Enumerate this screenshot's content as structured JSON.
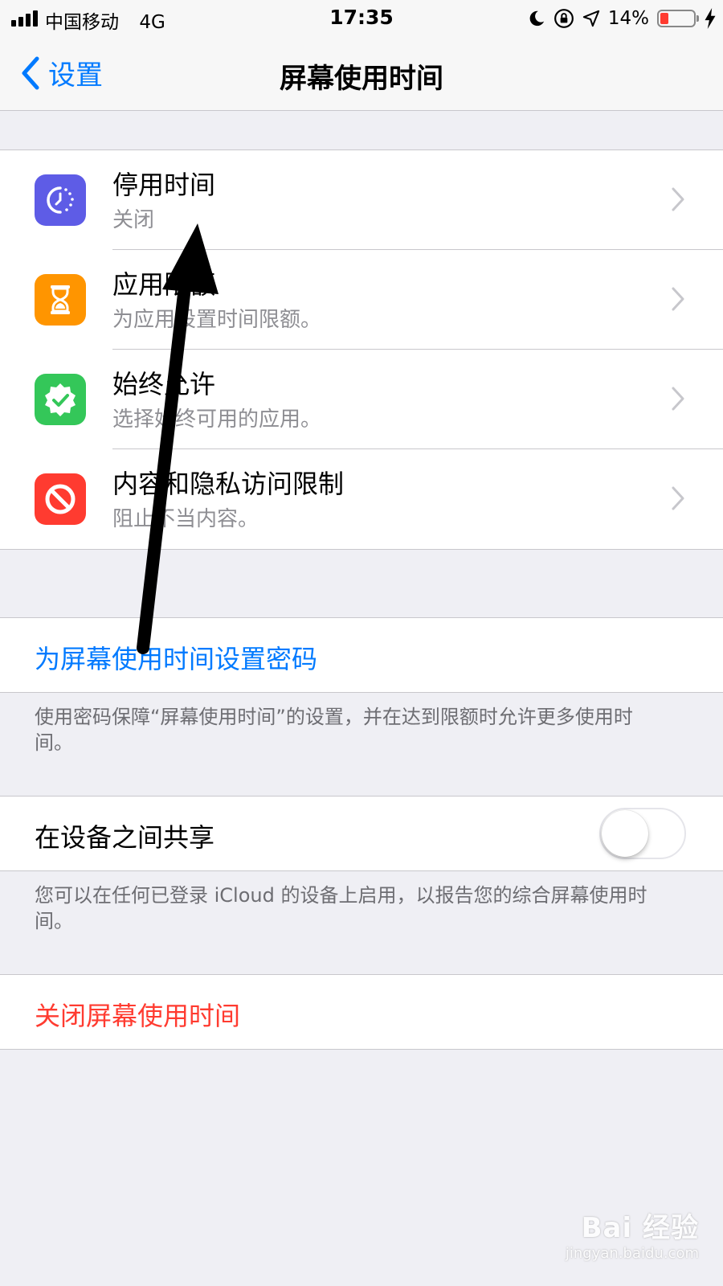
{
  "status_bar": {
    "carrier": "中国移动",
    "network": "4G",
    "time": "17:35",
    "battery": "14%"
  },
  "nav": {
    "back_label": "设置",
    "title": "屏幕使用时间"
  },
  "options": [
    {
      "title": "停用时间",
      "subtitle": "关闭",
      "icon": "downtime-icon",
      "color": "#5e5ce6"
    },
    {
      "title": "应用限额",
      "subtitle": "为应用设置时间限额。",
      "icon": "hourglass-icon",
      "color": "#ff9500"
    },
    {
      "title": "始终允许",
      "subtitle": "选择始终可用的应用。",
      "icon": "checkmark-badge-icon",
      "color": "#34c759"
    },
    {
      "title": "内容和隐私访问限制",
      "subtitle": "阻止不当内容。",
      "icon": "no-entry-icon",
      "color": "#ff3b30"
    }
  ],
  "passcode": {
    "label": "为屏幕使用时间设置密码",
    "footnote": "使用密码保障“屏幕使用时间”的设置，并在达到限额时允许更多使用时间。",
    "color": "#007aff"
  },
  "share": {
    "label": "在设备之间共享",
    "enabled": false,
    "footnote": "您可以在任何已登录 iCloud 的设备上启用，以报告您的综合屏幕使用时间。"
  },
  "turn_off": {
    "label": "关闭屏幕使用时间",
    "color": "#ff3b30"
  },
  "watermark": {
    "main": "Bai 经验",
    "sub": "jingyan.baidu.com"
  }
}
